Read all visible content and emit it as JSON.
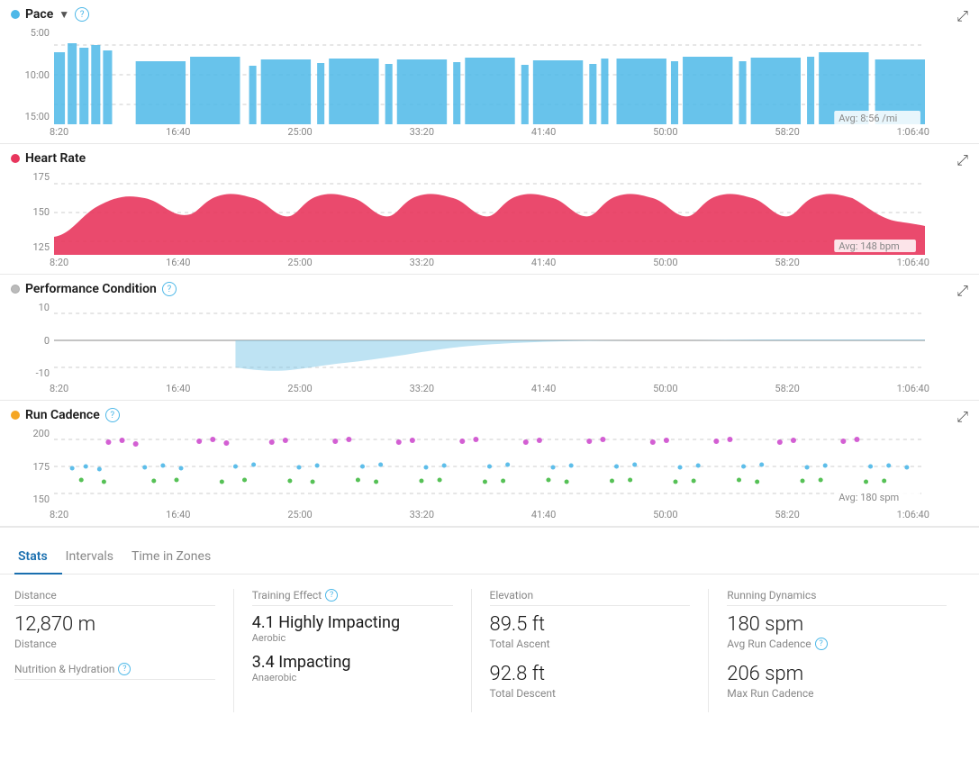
{
  "charts": {
    "pace": {
      "title": "Pace",
      "dot_color": "blue",
      "has_dropdown": true,
      "y_labels": [
        "5:00",
        "10:00",
        "15:00"
      ],
      "x_labels": [
        "8:20",
        "16:40",
        "25:00",
        "33:20",
        "41:40",
        "50:00",
        "58:20",
        "1:06:40"
      ],
      "avg_label": "Avg: 8:56 /mi"
    },
    "heart_rate": {
      "title": "Heart Rate",
      "dot_color": "red",
      "y_labels": [
        "175",
        "150",
        "125"
      ],
      "x_labels": [
        "8:20",
        "16:40",
        "25:00",
        "33:20",
        "41:40",
        "50:00",
        "58:20",
        "1:06:40"
      ],
      "avg_label": "Avg: 148 bpm"
    },
    "performance": {
      "title": "Performance Condition",
      "dot_color": "gray",
      "has_help": true,
      "y_labels": [
        "10",
        "0",
        "-10"
      ],
      "x_labels": [
        "8:20",
        "16:40",
        "25:00",
        "33:20",
        "41:40",
        "50:00",
        "58:20",
        "1:06:40"
      ]
    },
    "cadence": {
      "title": "Run Cadence",
      "dot_color": "orange",
      "has_help": true,
      "y_labels": [
        "200",
        "175",
        "150"
      ],
      "x_labels": [
        "8:20",
        "16:40",
        "25:00",
        "33:20",
        "41:40",
        "50:00",
        "58:20",
        "1:06:40"
      ],
      "avg_label": "Avg: 180 spm"
    }
  },
  "tabs": {
    "items": [
      "Stats",
      "Intervals",
      "Time in Zones"
    ],
    "active": "Stats"
  },
  "stats": {
    "distance": {
      "section_label": "Distance",
      "value": "12,870 m",
      "sub_label": "Distance"
    },
    "training_effect": {
      "section_label": "Training Effect",
      "has_help": true,
      "aerobic_value": "4.1 Highly Impacting",
      "aerobic_label": "Aerobic",
      "anaerobic_value": "3.4 Impacting",
      "anaerobic_label": "Anaerobic"
    },
    "elevation": {
      "section_label": "Elevation",
      "ascent_value": "89.5 ft",
      "ascent_label": "Total Ascent",
      "descent_value": "92.8 ft",
      "descent_label": "Total Descent"
    },
    "running_dynamics": {
      "section_label": "Running Dynamics",
      "cadence_value": "180 spm",
      "cadence_label": "Avg Run Cadence",
      "has_help": true,
      "max_cadence_value": "206 spm",
      "max_cadence_label": "Max Run Cadence"
    }
  },
  "nutrition": {
    "label": "Nutrition & Hydration",
    "has_help": true
  }
}
